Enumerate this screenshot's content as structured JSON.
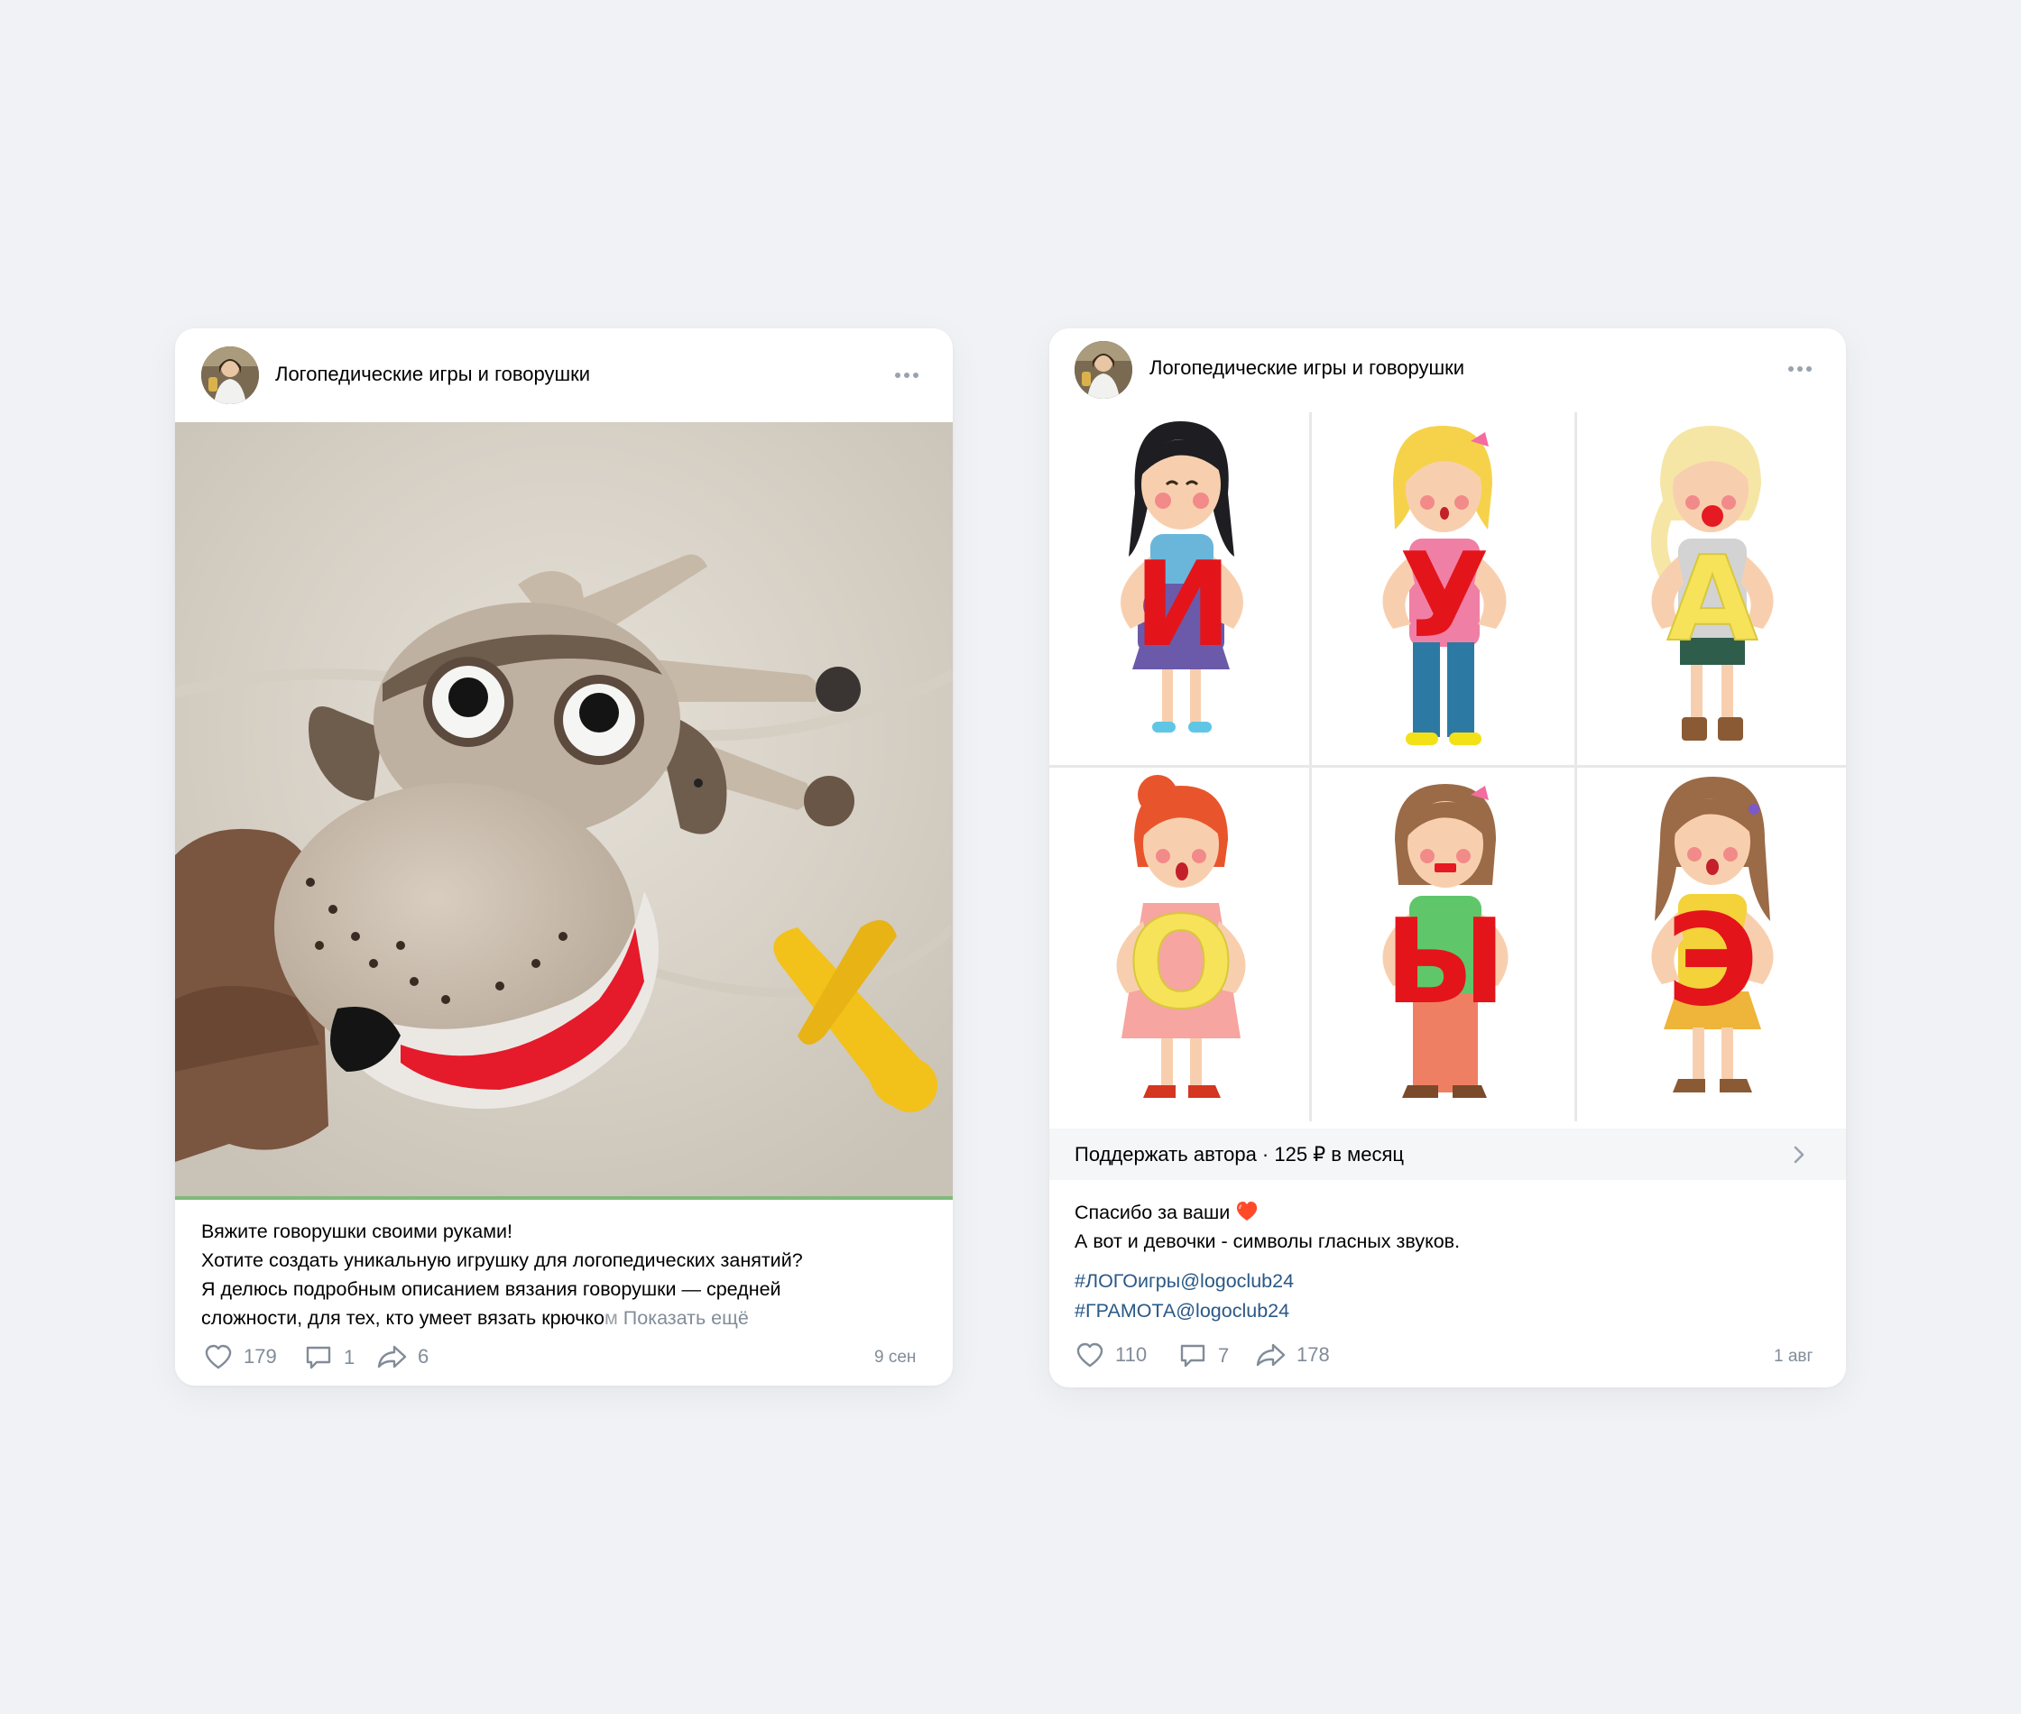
{
  "colors": {
    "background": "#f0f2f5",
    "card": "#ffffff",
    "link": "#2a5885",
    "muted": "#818c99"
  },
  "post1": {
    "author": "Логопедические игры и говорушки",
    "text_lines": [
      "Вяжите говорушки своими руками!",
      "Хотите создать уникальную игрушку для логопедических занятий?",
      "Я делюсь подробным описанием вязания говорушки — средней",
      "сложности, для тех, кто умеет вязать крючко"
    ],
    "text_fade": "м",
    "show_more": "Показать ещё",
    "likes": "179",
    "comments": "1",
    "shares": "6",
    "date": "9 сен",
    "icons": [
      "more-icon",
      "heart-icon",
      "comment-icon",
      "share-icon"
    ]
  },
  "post2": {
    "author": "Логопедические игры и говорушки",
    "images": [
      {
        "letter": "И",
        "letter_color": "#e4141b"
      },
      {
        "letter": "У",
        "letter_color": "#e4141b"
      },
      {
        "letter": "А",
        "letter_color": "#f6e35a"
      },
      {
        "letter": "О",
        "letter_color": "#f6e35a"
      },
      {
        "letter": "Ы",
        "letter_color": "#e4141b"
      },
      {
        "letter": "Э",
        "letter_color": "#e4141b"
      }
    ],
    "support_label": "Поддержать автора · 125 ₽ в месяц",
    "text_line1": "Спасибо за ваши",
    "text_line2": "А вот и девочки - символы гласных звуков.",
    "hashtags": [
      "#ЛОГОигры@logoclub24",
      "#ГРАМОТА@logoclub24"
    ],
    "likes": "110",
    "comments": "7",
    "shares": "178",
    "date": "1 авг",
    "icons": [
      "more-icon",
      "heart-emoji-icon",
      "chevron-right-icon",
      "heart-icon",
      "comment-icon",
      "share-icon"
    ]
  }
}
